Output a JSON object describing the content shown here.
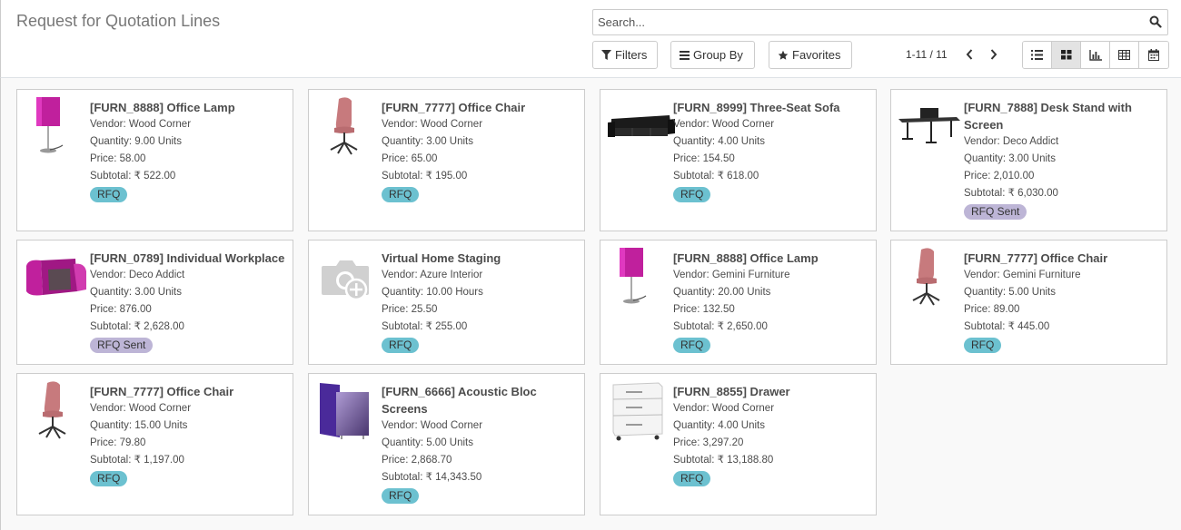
{
  "page": {
    "title": "Request for Quotation Lines"
  },
  "search": {
    "placeholder": "Search..."
  },
  "toolbar": {
    "filters": "Filters",
    "group_by": "Group By",
    "favorites": "Favorites"
  },
  "pager": {
    "value": "1-11 / 11"
  },
  "views": [
    "list-view-icon",
    "kanban-view-icon",
    "graph-view-icon",
    "pivot-view-icon",
    "calendar-view-icon"
  ],
  "active_view": "kanban",
  "colors": {
    "rfq": "#6cc1d0",
    "rfq_sent": "#bdb5d6",
    "accent": "#875a7b"
  },
  "cards": [
    {
      "name": "[FURN_8888] Office Lamp",
      "vendor": "Vendor: Wood Corner",
      "quantity": "Quantity: 9.00 Units",
      "price": "Price: 58.00",
      "subtotal": "Subtotal: ₹ 522.00",
      "status": "RFQ",
      "image": "lamp"
    },
    {
      "name": "[FURN_7777] Office Chair",
      "vendor": "Vendor: Wood Corner",
      "quantity": "Quantity: 3.00 Units",
      "price": "Price: 65.00",
      "subtotal": "Subtotal: ₹ 195.00",
      "status": "RFQ",
      "image": "chair"
    },
    {
      "name": "[FURN_8999] Three-Seat Sofa",
      "vendor": "Vendor: Wood Corner",
      "quantity": "Quantity: 4.00 Units",
      "price": "Price: 154.50",
      "subtotal": "Subtotal: ₹ 618.00",
      "status": "RFQ",
      "image": "sofa"
    },
    {
      "name": "[FURN_7888] Desk Stand with Screen",
      "vendor": "Vendor: Deco Addict",
      "quantity": "Quantity: 3.00 Units",
      "price": "Price: 2,010.00",
      "subtotal": "Subtotal: ₹ 6,030.00",
      "status": "RFQ Sent",
      "image": "desk"
    },
    {
      "name": "[FURN_0789] Individual Workplace",
      "vendor": "Vendor: Deco Addict",
      "quantity": "Quantity: 3.00 Units",
      "price": "Price: 876.00",
      "subtotal": "Subtotal: ₹ 2,628.00",
      "status": "RFQ Sent",
      "image": "workplace"
    },
    {
      "name": "Virtual Home Staging",
      "vendor": "Vendor: Azure Interior",
      "quantity": "Quantity: 10.00 Hours",
      "price": "Price: 25.50",
      "subtotal": "Subtotal: ₹ 255.00",
      "status": "RFQ",
      "image": "placeholder"
    },
    {
      "name": "[FURN_8888] Office Lamp",
      "vendor": "Vendor: Gemini Furniture",
      "quantity": "Quantity: 20.00 Units",
      "price": "Price: 132.50",
      "subtotal": "Subtotal: ₹ 2,650.00",
      "status": "RFQ",
      "image": "lamp"
    },
    {
      "name": "[FURN_7777] Office Chair",
      "vendor": "Vendor: Gemini Furniture",
      "quantity": "Quantity: 5.00 Units",
      "price": "Price: 89.00",
      "subtotal": "Subtotal: ₹ 445.00",
      "status": "RFQ",
      "image": "chair"
    },
    {
      "name": "[FURN_7777] Office Chair",
      "vendor": "Vendor: Wood Corner",
      "quantity": "Quantity: 15.00 Units",
      "price": "Price: 79.80",
      "subtotal": "Subtotal: ₹ 1,197.00",
      "status": "RFQ",
      "image": "chair"
    },
    {
      "name": "[FURN_6666] Acoustic Bloc Screens",
      "vendor": "Vendor: Wood Corner",
      "quantity": "Quantity: 5.00 Units",
      "price": "Price: 2,868.70",
      "subtotal": "Subtotal: ₹ 14,343.50",
      "status": "RFQ",
      "image": "screens"
    },
    {
      "name": "[FURN_8855] Drawer",
      "vendor": "Vendor: Wood Corner",
      "quantity": "Quantity: 4.00 Units",
      "price": "Price: 3,297.20",
      "subtotal": "Subtotal: ₹ 13,188.80",
      "status": "RFQ",
      "image": "drawer"
    }
  ]
}
